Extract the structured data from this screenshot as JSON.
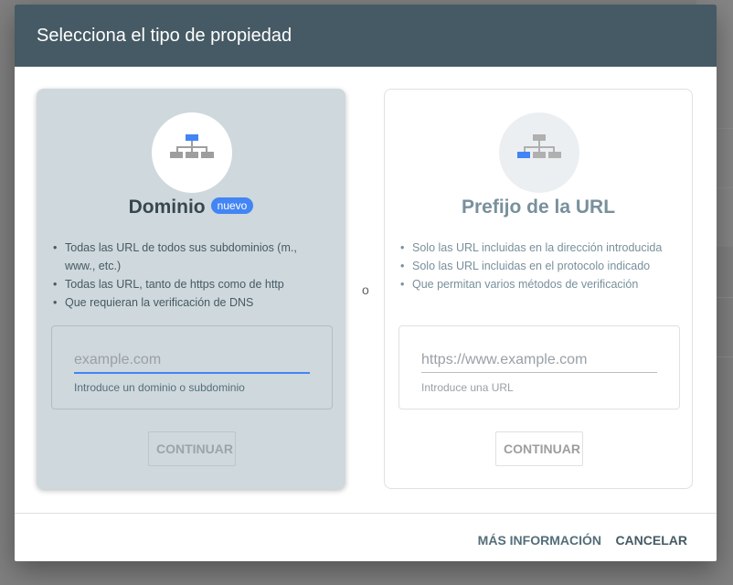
{
  "dialog": {
    "title": "Selecciona el tipo de propiedad",
    "or_label": "o",
    "more_info": "MÁS INFORMACIÓN",
    "cancel": "CANCELAR"
  },
  "domain_card": {
    "title": "Dominio",
    "badge": "nuevo",
    "bullets": [
      "Todas las URL de todos sus subdominios (m., www., etc.)",
      "Todas las URL, tanto de https como de http",
      "Que requieran la verificación de DNS"
    ],
    "input_placeholder": "example.com",
    "helper": "Introduce un dominio o subdominio",
    "button": "CONTINUAR",
    "icon": "sitemap-icon"
  },
  "prefix_card": {
    "title": "Prefijo de la URL",
    "bullets": [
      "Solo las URL incluidas en la dirección introducida",
      "Solo las URL incluidas en el protocolo indicado",
      "Que permitan varios métodos de verificación"
    ],
    "input_placeholder": "https://www.example.com",
    "helper": "Introduce una URL",
    "button": "CONTINUAR",
    "icon": "sitemap-icon"
  },
  "colors": {
    "header": "#455a64",
    "accent": "#4285f4",
    "selected_card": "#cfd8dc"
  }
}
